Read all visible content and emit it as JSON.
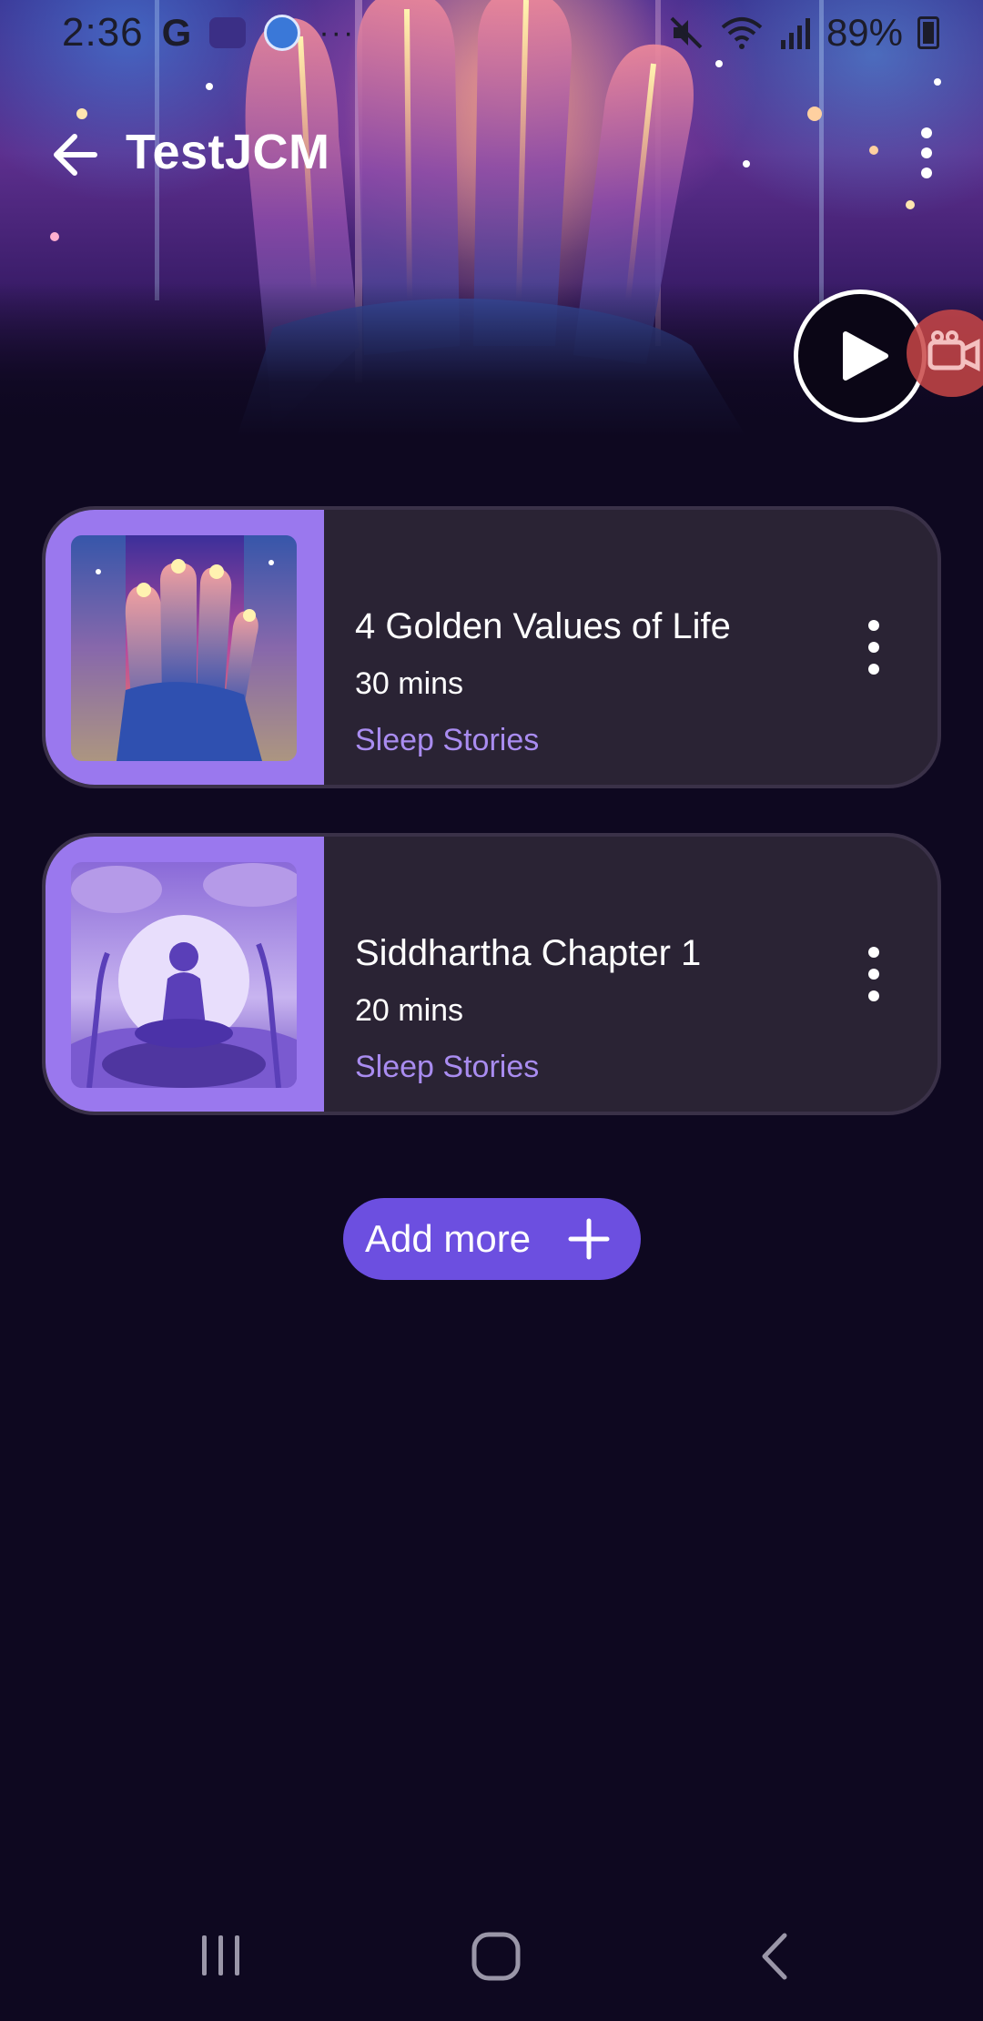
{
  "status_bar": {
    "time": "2:36",
    "google_glyph": "G",
    "battery_percent": "89%",
    "notification_dots": "···",
    "icons": [
      "google-icon",
      "teams-icon",
      "app-icon",
      "more-notifications-icon",
      "mute-icon",
      "wifi-icon",
      "signal-icon",
      "battery-charging-icon"
    ]
  },
  "app_bar": {
    "title": "TestJCM",
    "back_icon": "arrow-left-icon",
    "menu_icon": "more-vertical-icon"
  },
  "hero": {
    "play_icon": "play-icon",
    "record_icon": "video-camera-icon"
  },
  "tracks": [
    {
      "title": "4 Golden Values of Life",
      "duration": "30 mins",
      "category": "Sleep Stories",
      "thumb_icon": "glowing-hand-artwork"
    },
    {
      "title": "Siddhartha Chapter 1",
      "duration": "20 mins",
      "category": "Sleep Stories",
      "thumb_icon": "meditating-monk-artwork"
    }
  ],
  "add_more": {
    "label": "Add more",
    "icon": "plus-icon"
  },
  "colors": {
    "background": "#0e0820",
    "card": "#2a2334",
    "card_art_panel": "#9a78ee",
    "category_text": "#a98cf0",
    "add_button": "#6c4fe0"
  },
  "nav_bar": {
    "icons": [
      "recents-icon",
      "home-icon",
      "back-icon"
    ]
  }
}
